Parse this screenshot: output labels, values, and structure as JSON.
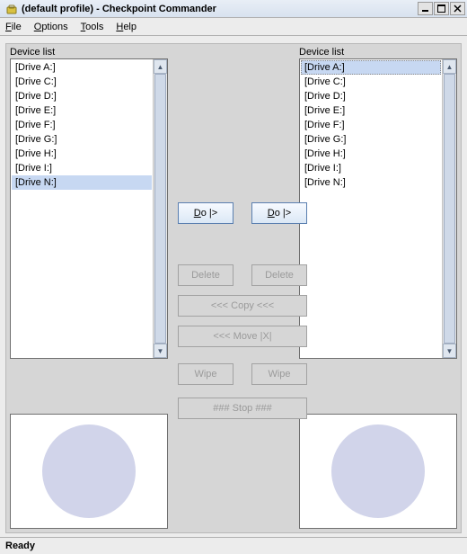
{
  "title": "(default profile) - Checkpoint Commander",
  "window": {
    "min": "_",
    "max": "❐",
    "close": "✕"
  },
  "menu": {
    "file": {
      "u": "F",
      "rest": "ile"
    },
    "options": {
      "u": "O",
      "rest": "ptions"
    },
    "tools": {
      "u": "T",
      "rest": "ools"
    },
    "help": {
      "u": "H",
      "rest": "elp"
    }
  },
  "panels": {
    "left": {
      "label": "Device list",
      "items": [
        "[Drive A:]",
        "[Drive C:]",
        "[Drive D:]",
        "[Drive E:]",
        "[Drive F:]",
        "[Drive G:]",
        "[Drive H:]",
        "[Drive I:]",
        "[Drive N:]"
      ],
      "selected_index": 8
    },
    "right": {
      "label": "Device list",
      "items": [
        "[Drive A:]",
        "[Drive C:]",
        "[Drive D:]",
        "[Drive E:]",
        "[Drive F:]",
        "[Drive G:]",
        "[Drive H:]",
        "[Drive I:]",
        "[Drive N:]"
      ],
      "selected_index": 0
    }
  },
  "buttons": {
    "do": {
      "u": "D",
      "rest": "o |>"
    },
    "delete": "Delete",
    "copy": "<<< Copy <<<",
    "move": "<<< Move |X|",
    "wipe": "Wipe",
    "stop": "### Stop ###"
  },
  "status": "Ready"
}
